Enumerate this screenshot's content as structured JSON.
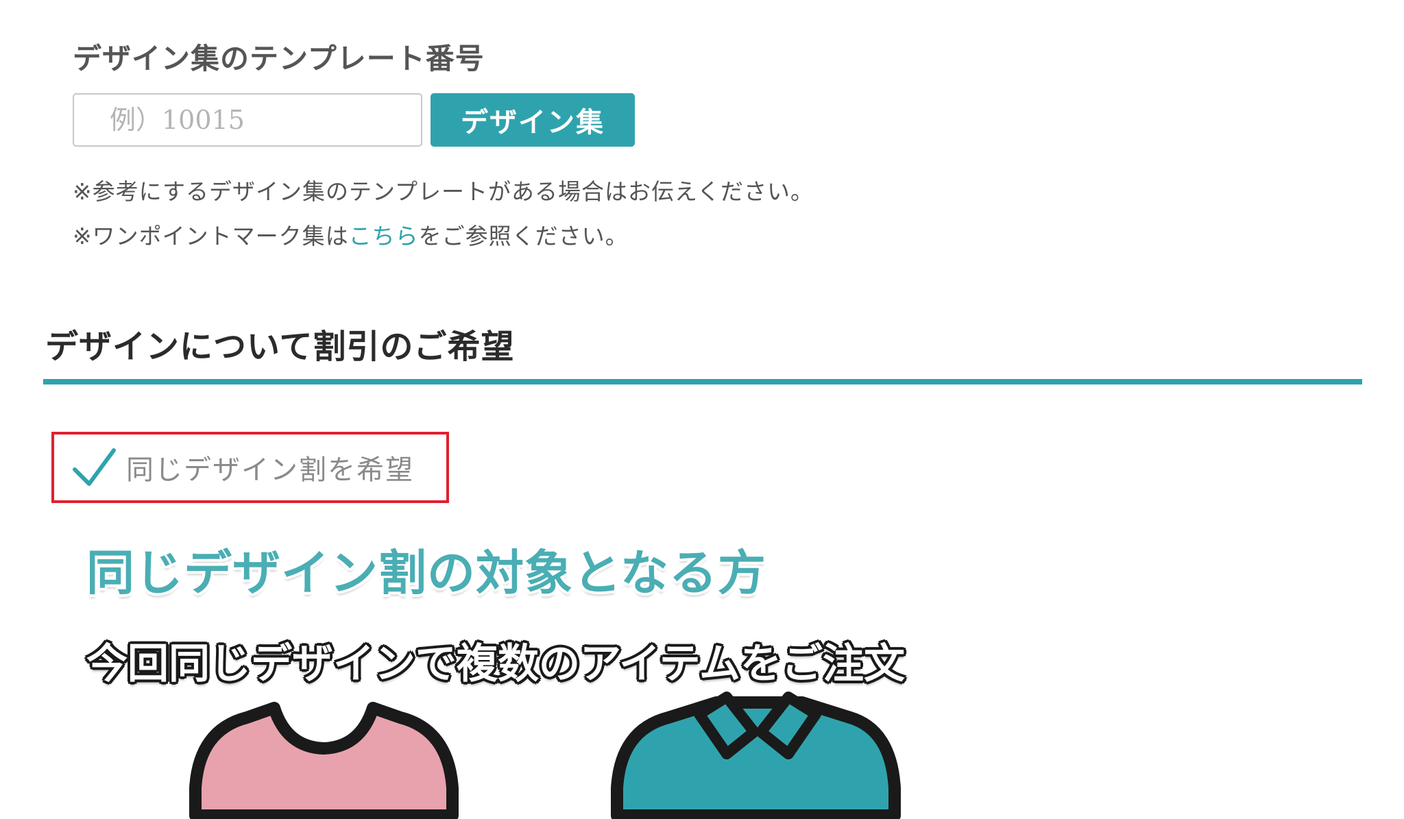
{
  "template": {
    "label": "デザイン集のテンプレート番号",
    "input_value": "",
    "input_placeholder": "例）10015",
    "button_label": "デザイン集",
    "note1": "※参考にするデザイン集のテンプレートがある場合はお伝えください。",
    "note2_prefix": "※ワンポイントマーク集は",
    "note2_link": "こちら",
    "note2_suffix": "をご参照ください。"
  },
  "discount": {
    "section_title": "デザインについて割引のご希望",
    "checkbox_label": "同じデザイン割を希望",
    "checked": true
  },
  "promo": {
    "title": "同じデザイン割の対象となる方",
    "subtitle": "今回同じデザインで複数のアイテムをご注文"
  },
  "colors": {
    "accent": "#2fa3ad",
    "highlight_border": "#e0202f",
    "shirt_pink": "#e8a2ad",
    "shirt_teal": "#2fa3ad"
  },
  "icons": {
    "check": "check-icon",
    "items": [
      "tshirt-icon",
      "polo-shirt-icon"
    ]
  }
}
